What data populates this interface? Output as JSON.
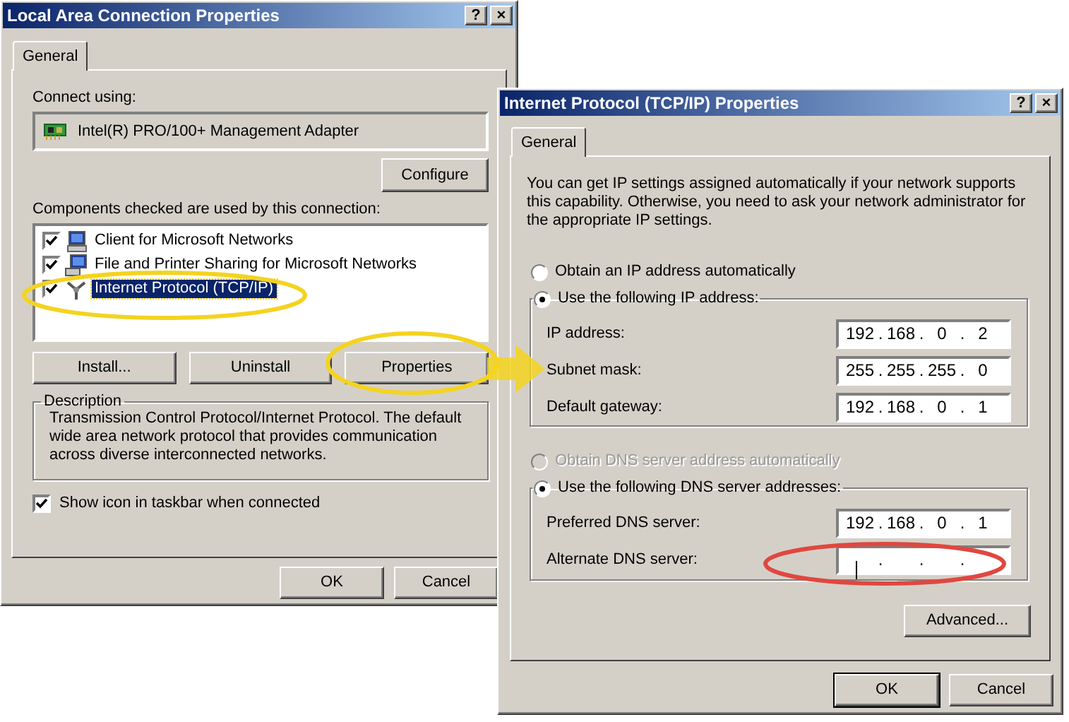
{
  "connection_window": {
    "title": "Local Area Connection Properties",
    "title_buttons": [
      "?",
      "×"
    ],
    "tabs": [
      {
        "label": "General",
        "selected": true
      }
    ],
    "connect_using_label": "Connect using:",
    "adapter": "Intel(R) PRO/100+ Management Adapter",
    "configure_button": "Configure",
    "components_label": "Components checked are used by this connection:",
    "components": [
      {
        "kind": "client",
        "label": "Client for Microsoft Networks",
        "checked": true,
        "selected": false
      },
      {
        "kind": "service",
        "label": "File and Printer Sharing for Microsoft Networks",
        "checked": true,
        "selected": false
      },
      {
        "kind": "protocol",
        "label": "Internet Protocol (TCP/IP)",
        "checked": true,
        "selected": true
      }
    ],
    "component_buttons": [
      "Install...",
      "Uninstall",
      "Properties"
    ],
    "description": {
      "title": "Description",
      "text": "Transmission Control Protocol/Internet Protocol. The default wide area network protocol that provides communication across diverse interconnected networks."
    },
    "show_icon": {
      "label": "Show icon in taskbar when connected",
      "checked": true
    },
    "dialog_buttons": [
      "OK",
      "Cancel"
    ]
  },
  "tcpip_window": {
    "title": "Internet Protocol (TCP/IP) Properties",
    "title_buttons": [
      "?",
      "×"
    ],
    "tabs": [
      {
        "label": "General",
        "selected": true
      }
    ],
    "intro": "You can get IP settings assigned automatically if your network supports this capability. Otherwise, you need to ask your network administrator for the appropriate IP settings.",
    "ip_options": [
      {
        "label": "Obtain an IP address automatically",
        "selected": false,
        "disabled": false
      },
      {
        "label": "Use the following IP address:",
        "selected": true,
        "disabled": false
      }
    ],
    "ip_fields": [
      {
        "label": "IP address:",
        "focused": false,
        "segments": [
          {
            "kind": "octet",
            "text": "192"
          },
          {
            "kind": "dot",
            "text": "."
          },
          {
            "kind": "octet",
            "text": "168"
          },
          {
            "kind": "dot",
            "text": "."
          },
          {
            "kind": "octet",
            "text": "0"
          },
          {
            "kind": "dot",
            "text": "."
          },
          {
            "kind": "octet",
            "text": "2"
          }
        ]
      },
      {
        "label": "Subnet mask:",
        "focused": false,
        "segments": [
          {
            "kind": "octet",
            "text": "255"
          },
          {
            "kind": "dot",
            "text": "."
          },
          {
            "kind": "octet",
            "text": "255"
          },
          {
            "kind": "dot",
            "text": "."
          },
          {
            "kind": "octet",
            "text": "255"
          },
          {
            "kind": "dot",
            "text": "."
          },
          {
            "kind": "octet",
            "text": "0"
          }
        ]
      },
      {
        "label": "Default gateway:",
        "focused": false,
        "segments": [
          {
            "kind": "octet",
            "text": "192"
          },
          {
            "kind": "dot",
            "text": "."
          },
          {
            "kind": "octet",
            "text": "168"
          },
          {
            "kind": "dot",
            "text": "."
          },
          {
            "kind": "octet",
            "text": "0"
          },
          {
            "kind": "dot",
            "text": "."
          },
          {
            "kind": "octet",
            "text": "1"
          }
        ]
      }
    ],
    "dns_options": [
      {
        "label": "Obtain DNS server address automatically",
        "selected": false,
        "disabled": true
      },
      {
        "label": "Use the following DNS server addresses:",
        "selected": true,
        "disabled": false
      }
    ],
    "dns_fields": [
      {
        "label": "Preferred DNS server:",
        "focused": false,
        "segments": [
          {
            "kind": "octet",
            "text": "192"
          },
          {
            "kind": "dot",
            "text": "."
          },
          {
            "kind": "octet",
            "text": "168"
          },
          {
            "kind": "dot",
            "text": "."
          },
          {
            "kind": "octet",
            "text": "0"
          },
          {
            "kind": "dot",
            "text": "."
          },
          {
            "kind": "octet",
            "text": "1"
          }
        ]
      },
      {
        "label": "Alternate DNS server:",
        "focused": true,
        "segments": [
          {
            "kind": "octet"
          },
          {
            "kind": "dot",
            "text": "."
          },
          {
            "kind": "octet"
          },
          {
            "kind": "dot",
            "text": "."
          },
          {
            "kind": "octet"
          },
          {
            "kind": "dot",
            "text": "."
          },
          {
            "kind": "octet"
          }
        ]
      }
    ],
    "advanced_button": "Advanced...",
    "dialog_buttons": [
      "OK",
      "Cancel"
    ]
  },
  "annotations": [
    {
      "kind": "ellipse",
      "color": "#f4d320"
    },
    {
      "kind": "ellipse",
      "color": "#f4d320"
    },
    {
      "kind": "arrow",
      "color": "#f4d320"
    },
    {
      "kind": "ellipse",
      "color": "#e0473f"
    }
  ]
}
